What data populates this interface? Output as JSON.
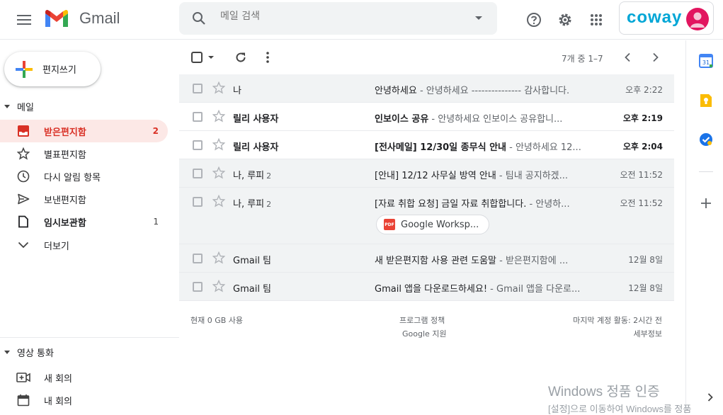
{
  "header": {
    "app_name": "Gmail",
    "search_placeholder": "메일 검색",
    "brand_logo": "coway"
  },
  "sidebar": {
    "compose_label": "편지쓰기",
    "mail_section": "메일",
    "items": [
      {
        "label": "받은편지함",
        "count": "2",
        "icon": "inbox-icon"
      },
      {
        "label": "별표편지함",
        "count": "",
        "icon": "star-icon"
      },
      {
        "label": "다시 알림 항목",
        "count": "",
        "icon": "clock-icon"
      },
      {
        "label": "보낸편지함",
        "count": "",
        "icon": "send-icon"
      },
      {
        "label": "임시보관함",
        "count": "1",
        "icon": "draft-icon"
      },
      {
        "label": "더보기",
        "count": "",
        "icon": "chevron-down-icon"
      }
    ],
    "meet_section": "영상 통화",
    "meet_items": [
      {
        "label": "새 회의",
        "icon": "video-add-icon"
      },
      {
        "label": "내 회의",
        "icon": "calendar-icon"
      }
    ]
  },
  "toolbar": {
    "pager": "7개 중 1–7"
  },
  "emails": [
    {
      "sender": "나",
      "count": "",
      "subject": "안녕하세요",
      "snippet": " - 안녕하세요 --------------- 감사합니다.",
      "time": "오후 2:22",
      "unread": false
    },
    {
      "sender": "릴리 사용자",
      "count": "",
      "subject": "인보이스 공유",
      "snippet": " - 안녕하세요 인보이스 공유합니...",
      "time": "오후 2:19",
      "unread": true
    },
    {
      "sender": "릴리 사용자",
      "count": "",
      "subject": "[전사메일] 12/30일 종무식 안내",
      "snippet": " - 안녕하세요 12...",
      "time": "오후 2:04",
      "unread": true
    },
    {
      "sender": "나, 루피",
      "count": "2",
      "subject": "[안내] 12/12 사무실 방역 안내",
      "snippet": " - 팀내 공지하겠...",
      "time": "오전 11:52",
      "unread": false
    },
    {
      "sender": "나, 루피",
      "count": "2",
      "subject": "[자료 취합 요청] 금일 자료 취합합니다.",
      "snippet": " - 안녕하...",
      "time": "오전 11:52",
      "unread": false,
      "attachment": "Google Worksp..."
    },
    {
      "sender": "Gmail 팀",
      "count": "",
      "subject": "새 받은편지함 사용 관련 도움말",
      "snippet": " - 받은편지함에 ...",
      "time": "12월 8일",
      "unread": false
    },
    {
      "sender": "Gmail 팀",
      "count": "",
      "subject": "Gmail 앱을 다운로드하세요!",
      "snippet": " - Gmail 앱을 다운로...",
      "time": "12월 8일",
      "unread": false
    }
  ],
  "footer": {
    "storage": "현재 0 GB 사용",
    "policy": "프로그램 정책",
    "support": "Google 지원",
    "activity": "마지막 계정 활동: 2시간 전",
    "details": "세부정보"
  },
  "watermark": {
    "line1": "Windows 정품 인증",
    "line2": "[설정]으로 이동하여 Windows를 정품"
  },
  "colors": {
    "accent_red": "#d93025",
    "active_bg": "#fce8e6",
    "brand": "#00a6d6"
  }
}
